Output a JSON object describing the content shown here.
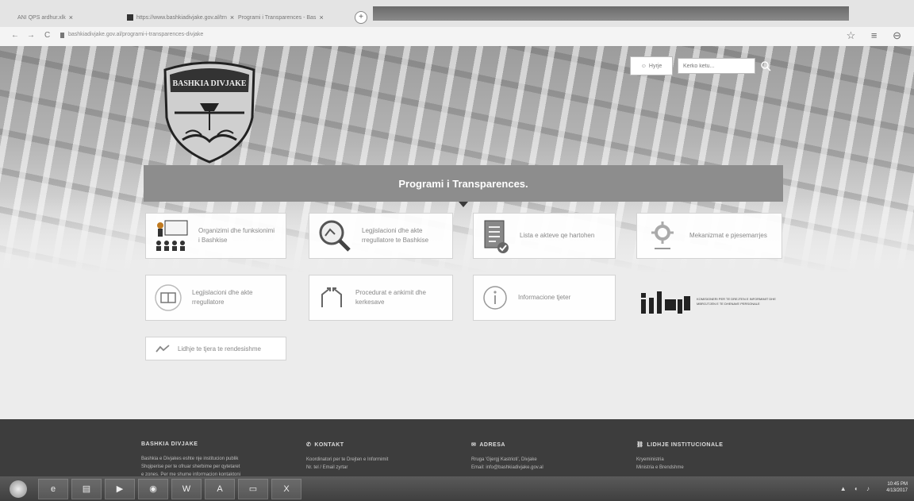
{
  "browser": {
    "tabs": [
      {
        "label": "ANI  QPS ardhur.xlk",
        "active": false
      },
      {
        "label": "https://www.bashkiadivjake.gov.al/trn",
        "active": true
      },
      {
        "label": "Programi i Transparences - Bas",
        "active": false
      }
    ],
    "new_tab_symbol": "+",
    "url": "bashkiadivjake.gov.al/programi-i-transparences-divjake",
    "nav": {
      "back": "←",
      "forward": "→",
      "reload": "C"
    },
    "right_icons": "☆ ≡ ⊖"
  },
  "header": {
    "logo_text": "BASHKIA DIVJAKE",
    "login_label": "Hyrje",
    "search_placeholder": "Kerko ketu..."
  },
  "banner": {
    "title": "Programi i Transparences."
  },
  "cards": [
    {
      "label": "Organizimi dhe funksionimi i Bashkise",
      "icon": "presenter-icon"
    },
    {
      "label": "Legjislacioni dhe akte rregullatore te Bashkise",
      "icon": "magnifier-icon"
    },
    {
      "label": "Lista e akteve qe hartohen",
      "icon": "clipboard-icon"
    },
    {
      "label": "Mekanizmat e pjesemarrjes",
      "icon": "gear-icon"
    },
    {
      "label": "Legjislacioni dhe akte rregullatore",
      "icon": "law-book-icon"
    },
    {
      "label": "Procedurat e ankimit dhe kerkesave",
      "icon": "arrows-icon"
    },
    {
      "label": "Informacione tjeter",
      "icon": "info-icon"
    }
  ],
  "idp_logo": {
    "mark": "idp",
    "text": "KOMISIONERI PER TE DREJTEN E INFORMIMIT DHE MBROJTJEN E TE DHENAVE PERSONALE"
  },
  "small_card": {
    "label": "Lidhje te tjera te rendesishme"
  },
  "footer": {
    "columns": [
      {
        "title": "BASHKIA DIVJAKE",
        "icon": "",
        "lines": [
          "Bashkia e Divjakes eshte nje institucion publik",
          "Shqiperise per te ofruar sherbime per qytetaret",
          "e zones. Per me shume informacion kontaktoni"
        ]
      },
      {
        "title": "KONTAKT",
        "icon": "phone-icon",
        "lines": [
          "Koordinatori per te Drejten e Informimit",
          "Nr. tel / Email zyrtar"
        ]
      },
      {
        "title": "ADRESA",
        "icon": "mail-icon",
        "lines": [
          "Rruga 'Gjergj Kastrioti', Divjake",
          "Email: info@bashkiadivjake.gov.al"
        ]
      },
      {
        "title": "LIDHJE INSTITUCIONALE",
        "icon": "link-icon",
        "lines": [
          "Kryeministria",
          "Ministria e Brendshme"
        ]
      }
    ]
  },
  "taskbar": {
    "items": [
      "IE",
      "Explorer",
      "Media",
      "Chrome",
      "Word",
      "Acrobat",
      "Folder",
      "Excel"
    ],
    "time": "10:45 PM",
    "date": "4/13/2017"
  }
}
